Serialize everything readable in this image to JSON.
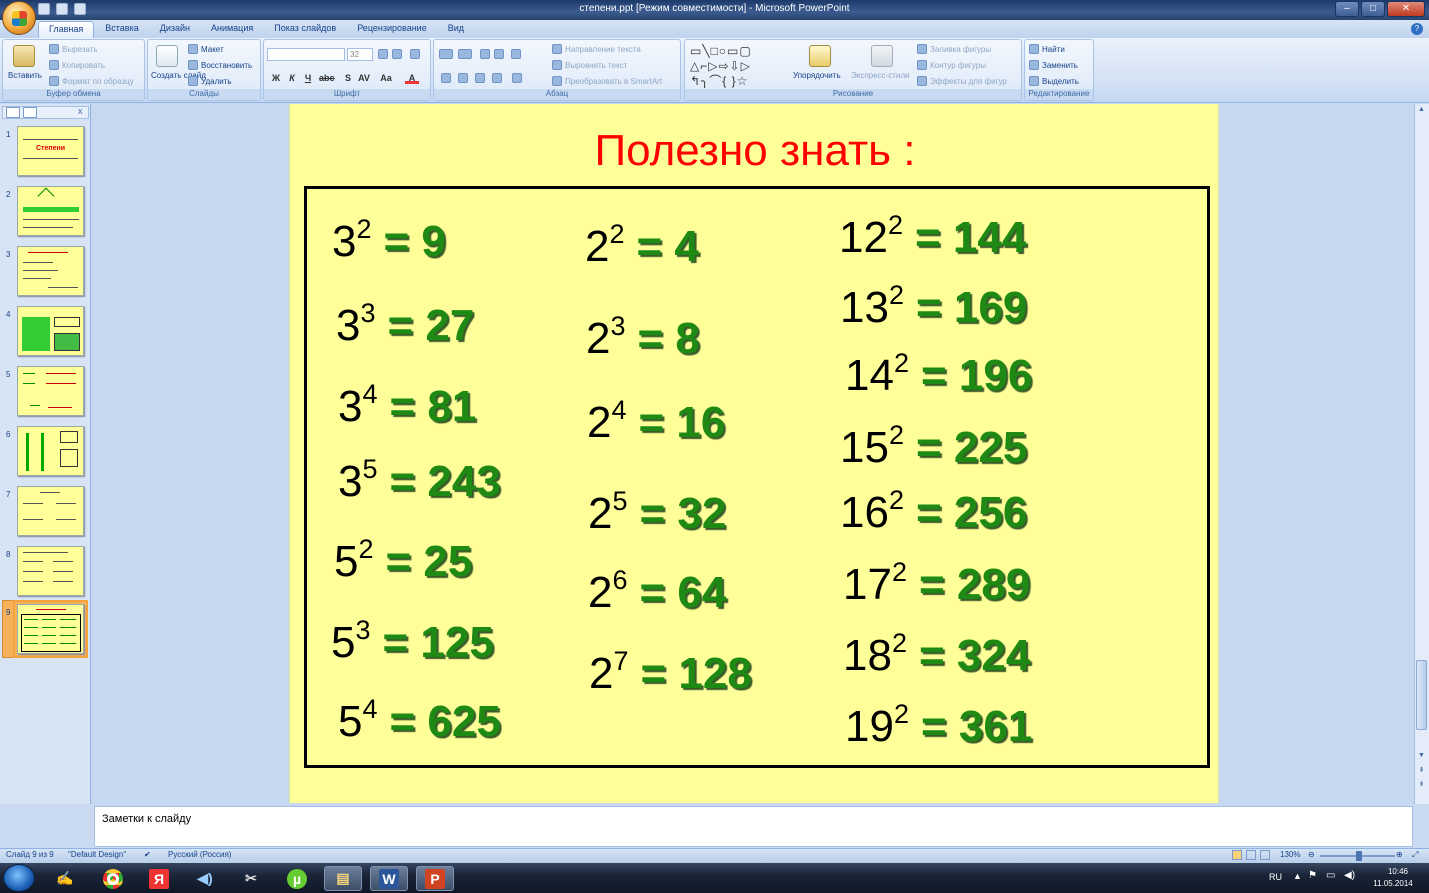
{
  "window": {
    "title": "степени.ppt [Режим совместимости] - Microsoft PowerPoint",
    "controls": {
      "minimize": "–",
      "maximize": "□",
      "close": "✕"
    }
  },
  "ribbon_tabs": [
    "Главная",
    "Вставка",
    "Дизайн",
    "Анимация",
    "Показ слайдов",
    "Рецензирование",
    "Вид"
  ],
  "ribbon": {
    "clipboard": {
      "paste": "Вставить",
      "cut": "Вырезать",
      "copy": "Копировать",
      "format_painter": "Формат по образцу",
      "group": "Буфер обмена"
    },
    "slides": {
      "new_slide": "Создать слайд",
      "layout": "Макет",
      "reset": "Восстановить",
      "delete": "Удалить",
      "group": "Слайды"
    },
    "font": {
      "font_size": "32",
      "group": "Шрифт"
    },
    "paragraph": {
      "text_direction": "Направление текста",
      "align_text": "Выровнять текст",
      "smartart": "Преобразовать в SmartArt",
      "group": "Абзац"
    },
    "drawing": {
      "arrange": "Упорядочить",
      "quick_styles": "Экспресс-стили",
      "shape_fill": "Заливка фигуры",
      "shape_outline": "Контур фигуры",
      "shape_effects": "Эффекты для фигур",
      "group": "Рисование"
    },
    "editing": {
      "find": "Найти",
      "replace": "Заменить",
      "select": "Выделить",
      "group": "Редактирование"
    }
  },
  "thumbnails": {
    "numbers": [
      "1",
      "2",
      "3",
      "4",
      "5",
      "6",
      "7",
      "8",
      "9"
    ],
    "slide1_title": "Степени",
    "selected": "9"
  },
  "slide": {
    "title": "Полезно знать :",
    "col1": [
      {
        "base": "3",
        "exp": "2",
        "result": "= 9"
      },
      {
        "base": "3",
        "exp": "3",
        "result": "= 27"
      },
      {
        "base": "3",
        "exp": "4",
        "result": "= 81"
      },
      {
        "base": "3",
        "exp": "5",
        "result": "= 243"
      },
      {
        "base": "5",
        "exp": "2",
        "result": "= 25"
      },
      {
        "base": "5",
        "exp": "3",
        "result": "= 125"
      },
      {
        "base": "5",
        "exp": "4",
        "result": "= 625"
      }
    ],
    "col2": [
      {
        "base": "2",
        "exp": "2",
        "result": "= 4"
      },
      {
        "base": "2",
        "exp": "3",
        "result": "= 8"
      },
      {
        "base": "2",
        "exp": "4",
        "result": "= 16"
      },
      {
        "base": "2",
        "exp": "5",
        "result": "= 32"
      },
      {
        "base": "2",
        "exp": "6",
        "result": "= 64"
      },
      {
        "base": "2",
        "exp": "7",
        "result": "= 128"
      }
    ],
    "col3": [
      {
        "base": "12",
        "exp": "2",
        "result": "= 144"
      },
      {
        "base": "13",
        "exp": "2",
        "result": "= 169"
      },
      {
        "base": "14",
        "exp": "2",
        "result": "= 196"
      },
      {
        "base": "15",
        "exp": "2",
        "result": "= 225"
      },
      {
        "base": "16",
        "exp": "2",
        "result": "= 256"
      },
      {
        "base": "17",
        "exp": "2",
        "result": "= 289"
      },
      {
        "base": "18",
        "exp": "2",
        "result": "= 324"
      },
      {
        "base": "19",
        "exp": "2",
        "result": "= 361"
      }
    ]
  },
  "notes": {
    "placeholder": "Заметки к слайду"
  },
  "status": {
    "slide_counter": "Слайд 9 из 9",
    "theme": "\"Default Design\"",
    "language": "Русский (Россия)",
    "zoom": "130%"
  },
  "taskbar": {
    "lang": "RU",
    "time": "10:46",
    "date": "11.05.2014",
    "apps": [
      "acrobat-icon",
      "chrome-icon",
      "yandex-icon",
      "media-icon",
      "paint-icon",
      "utorrent-icon",
      "explorer-icon",
      "word-icon",
      "powerpoint-icon"
    ]
  },
  "colors": {
    "slide_bg": "#ffff99",
    "title": "#ff0000",
    "result": "#1f8a13",
    "ribbon": "#d3e2f5"
  }
}
